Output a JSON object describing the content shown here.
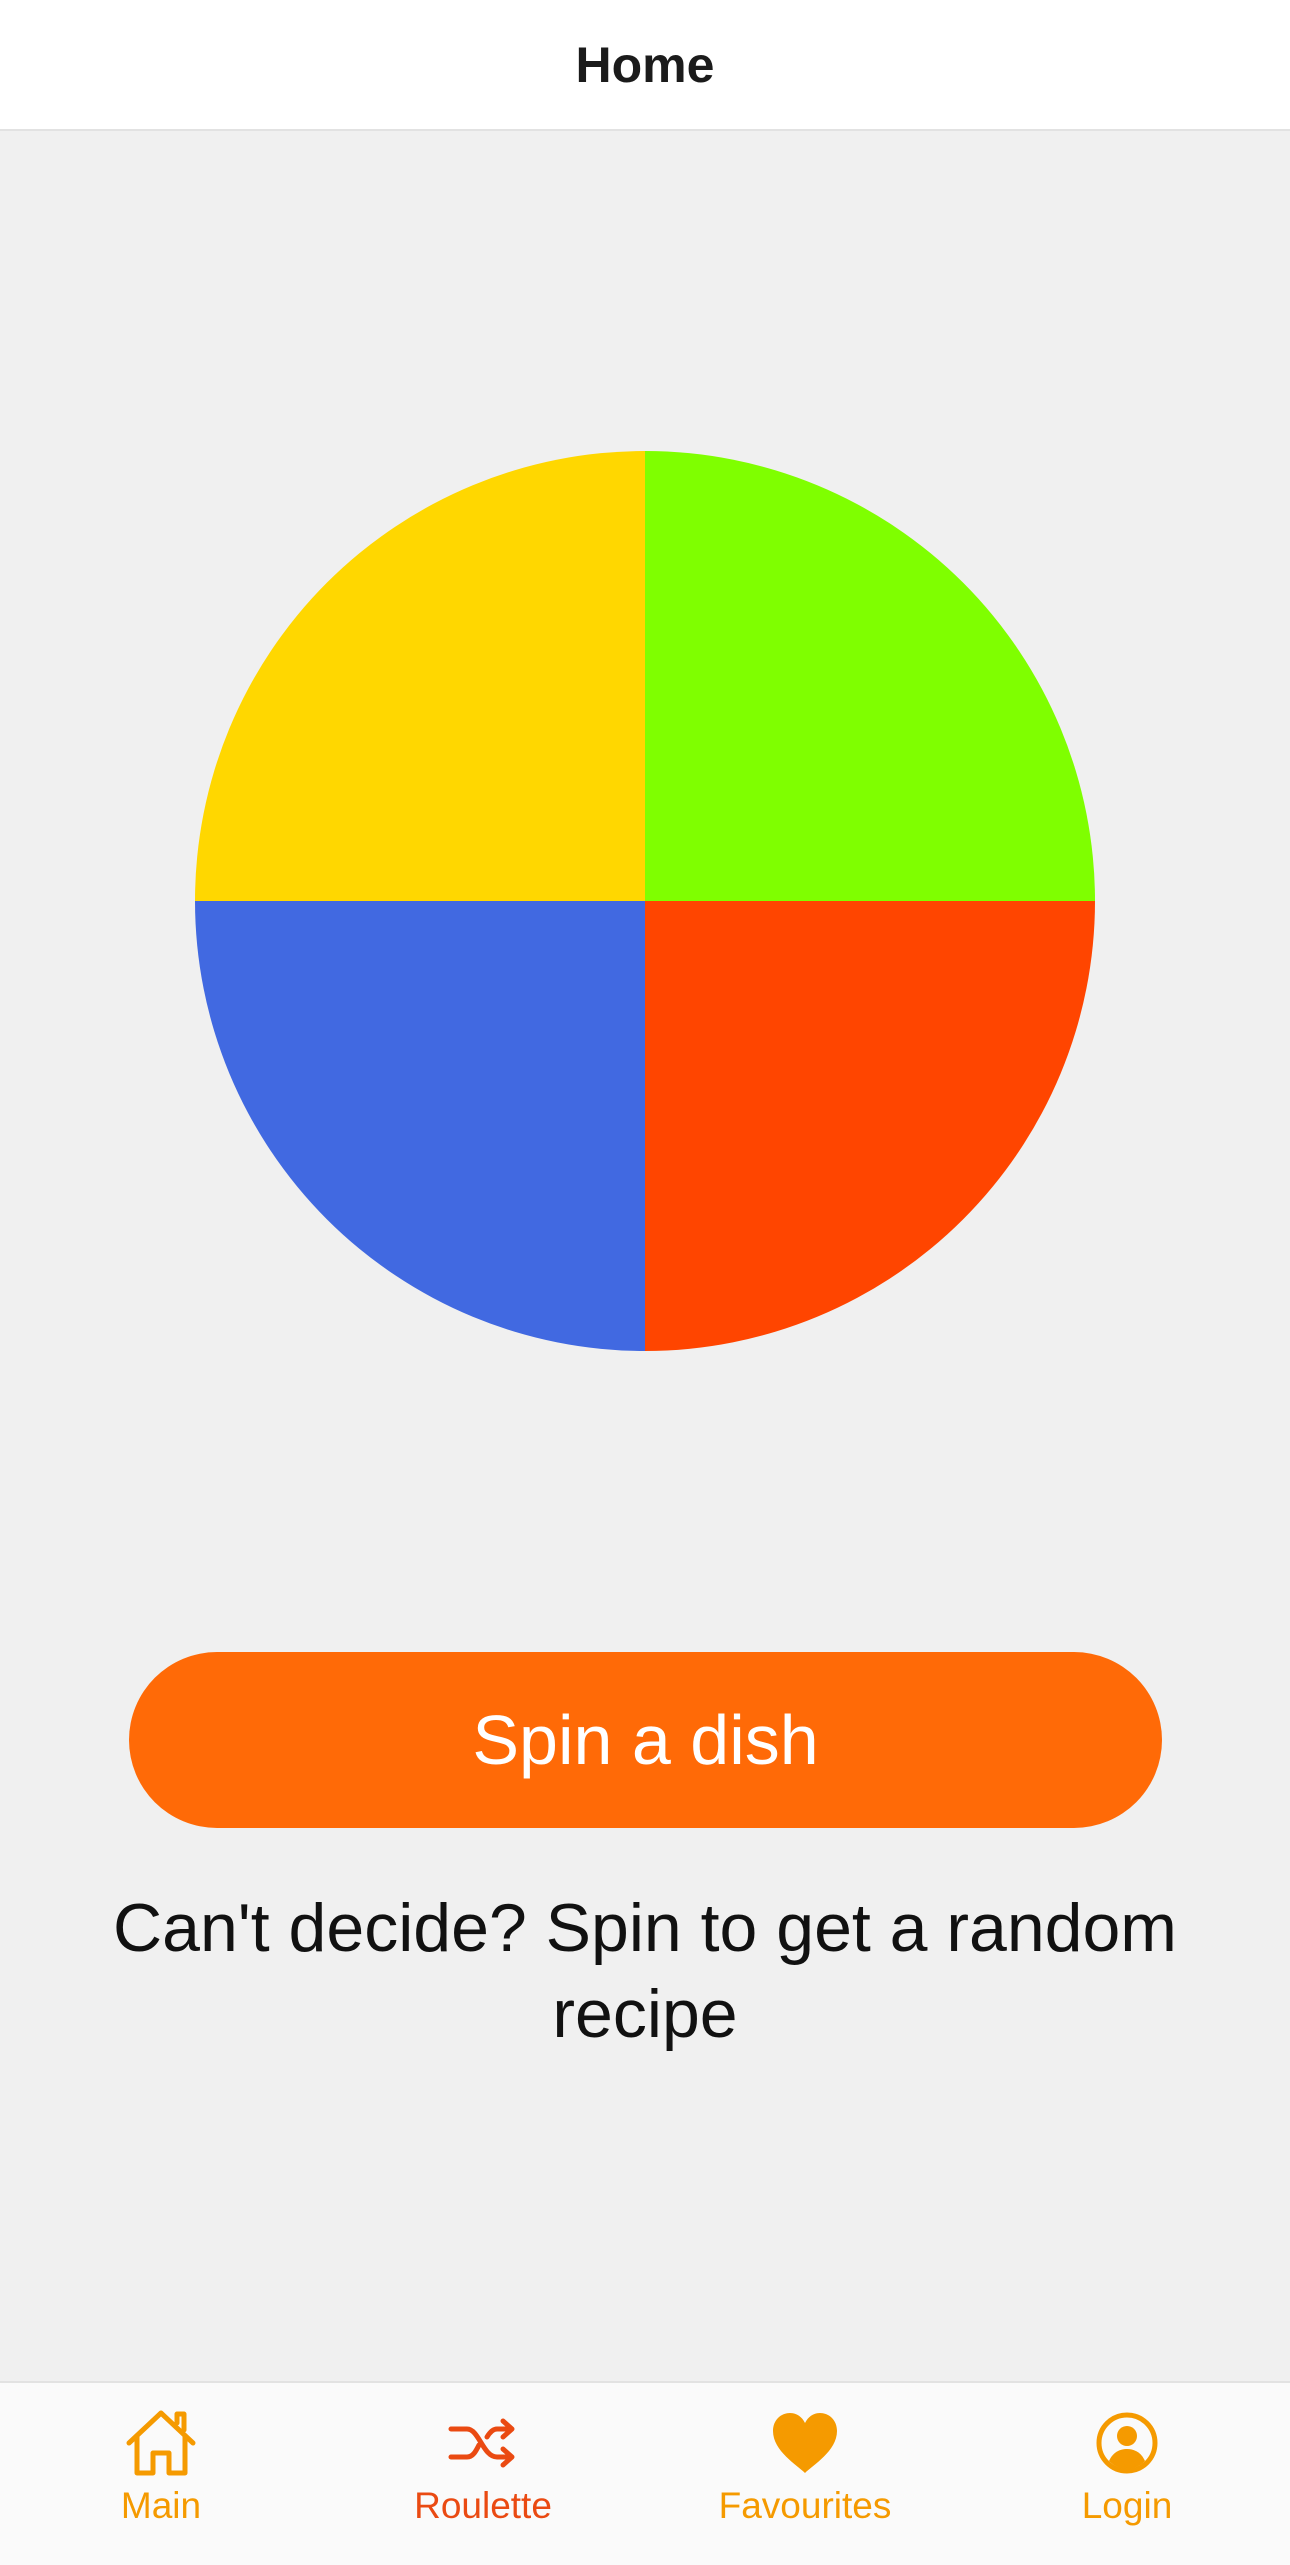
{
  "header": {
    "title": "Home"
  },
  "wheel": {
    "segments": [
      {
        "color": "#7fff00",
        "icon": "wheel-segment-green"
      },
      {
        "color": "#ff4500",
        "icon": "wheel-segment-red"
      },
      {
        "color": "#4169e1",
        "icon": "wheel-segment-blue"
      },
      {
        "color": "#ffd700",
        "icon": "wheel-segment-yellow"
      }
    ]
  },
  "spin_button": {
    "label": "Spin a dish",
    "color": "#ff6a07"
  },
  "hint": {
    "text": "Can't decide? Spin to get a random recipe"
  },
  "tabbar": {
    "inactive_color": "#f59a00",
    "active_color": "#ea4a12",
    "tabs": [
      {
        "label": "Main",
        "icon": "home-icon",
        "active": false
      },
      {
        "label": "Roulette",
        "icon": "shuffle-icon",
        "active": true
      },
      {
        "label": "Favourites",
        "icon": "heart-icon",
        "active": false
      },
      {
        "label": "Login",
        "icon": "user-circle-icon",
        "active": false
      }
    ]
  }
}
